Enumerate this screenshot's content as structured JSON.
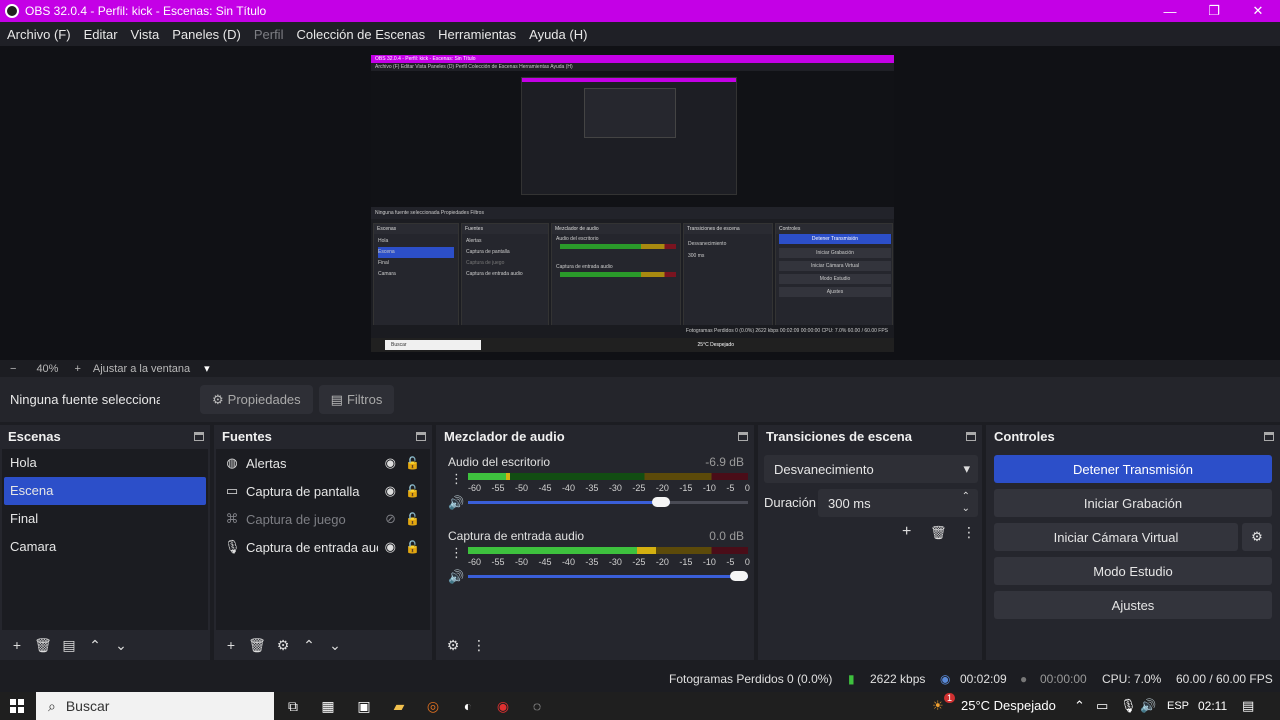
{
  "window": {
    "title": "OBS 32.0.4 - Perfil: kick - Escenas: Sin Título",
    "controls": [
      "—",
      "❐",
      "✕"
    ]
  },
  "menubar": {
    "items": [
      {
        "label": "Archivo (F)",
        "enabled": true
      },
      {
        "label": "Editar",
        "enabled": true
      },
      {
        "label": "Vista",
        "enabled": true
      },
      {
        "label": "Paneles (D)",
        "enabled": true
      },
      {
        "label": "Perfil",
        "enabled": false
      },
      {
        "label": "Colección de Escenas",
        "enabled": true
      },
      {
        "label": "Herramientas",
        "enabled": true
      },
      {
        "label": "Ayuda (H)",
        "enabled": true
      }
    ]
  },
  "zoom": {
    "minus": "−",
    "level": "40%",
    "plus": "+",
    "fit_label": "Ajustar a la ventana",
    "arrow": "▾"
  },
  "source_toolbar": {
    "no_selection": "Ninguna fuente seleccionada",
    "properties": "Propiedades",
    "filters": "Filtros"
  },
  "scenes": {
    "title": "Escenas",
    "items": [
      {
        "label": "Hola",
        "selected": false
      },
      {
        "label": "Escena",
        "selected": true
      },
      {
        "label": "Final",
        "selected": false
      },
      {
        "label": "Camara",
        "selected": false
      }
    ]
  },
  "sources": {
    "title": "Fuentes",
    "items": [
      {
        "label": "Alertas",
        "icon": "globe-icon",
        "visible": true
      },
      {
        "label": "Captura de pantalla",
        "icon": "monitor-icon",
        "visible": true
      },
      {
        "label": "Captura de juego",
        "icon": "gamepad-icon",
        "visible": false
      },
      {
        "label": "Captura de entrada audio",
        "icon": "microphone-icon",
        "visible": true
      }
    ]
  },
  "mixer": {
    "title": "Mezclador de audio",
    "ticks": [
      "-60",
      "-55",
      "-50",
      "-45",
      "-40",
      "-35",
      "-30",
      "-25",
      "-20",
      "-15",
      "-10",
      "-5",
      "0"
    ],
    "channels": [
      {
        "name": "Audio del escritorio",
        "db": "-6.9 dB",
        "level": 0.15,
        "volume": 0.72
      },
      {
        "name": "Captura de entrada audio",
        "db": "0.0 dB",
        "level": 0.67,
        "volume": 1.0
      }
    ]
  },
  "transitions": {
    "title": "Transiciones de escena",
    "selected": "Desvanecimiento",
    "duration_label": "Duración",
    "duration_value": "300 ms"
  },
  "controls": {
    "title": "Controles",
    "stop_stream": "Detener Transmisión",
    "start_recording": "Iniciar Grabación",
    "virtual_cam": "Iniciar Cámara Virtual",
    "studio_mode": "Modo Estudio",
    "settings": "Ajustes",
    "accent": "#2c4fc9"
  },
  "status": {
    "dropped_frames": "Fotogramas Perdidos 0 (0.0%)",
    "bitrate": "2622 kbps",
    "stream_time": "00:02:09",
    "rec_time": "00:00:00",
    "cpu": "CPU: 7.0%",
    "fps": "60.00 / 60.00 FPS"
  },
  "taskbar": {
    "search_placeholder": "Buscar",
    "weather_badge": "1",
    "weather": "25°C  Despejado",
    "language": "ESP",
    "time": "02:11"
  },
  "nested_preview": {
    "title": "OBS 32.0.4 - Perfil: kick - Escenas: Sin Título",
    "menu": "Archivo (F)   Editar   Vista   Paneles (D)   Perfil   Colección de Escenas   Herramientas   Ayuda (H)",
    "source_bar": "Ninguna fuente seleccionada       Propiedades       Filtros",
    "panels": [
      "Escenas",
      "Fuentes",
      "Mezclador de audio",
      "Transiciones de escena",
      "Controles"
    ],
    "scenes": [
      "Hola",
      "Escena",
      "Final",
      "Camara"
    ],
    "sources": [
      "Alertas",
      "Captura de pantalla",
      "Captura de juego",
      "Captura de entrada audio"
    ],
    "channels": [
      "Audio del escritorio",
      "Captura de entrada audio"
    ],
    "transition": "Desvanecimiento",
    "duration": "300 ms",
    "buttons": [
      "Detener Transmisión",
      "Iniciar Grabación",
      "Iniciar Cámara Virtual",
      "Modo Estudio",
      "Ajustes"
    ],
    "status": "Fotogramas Perdidos 0 (0.0%)   2622 kbps   00:02:09   00:00:00   CPU: 7.0%   60.00 / 60.00 FPS",
    "search": "Buscar",
    "weather": "25°C  Despejado"
  }
}
